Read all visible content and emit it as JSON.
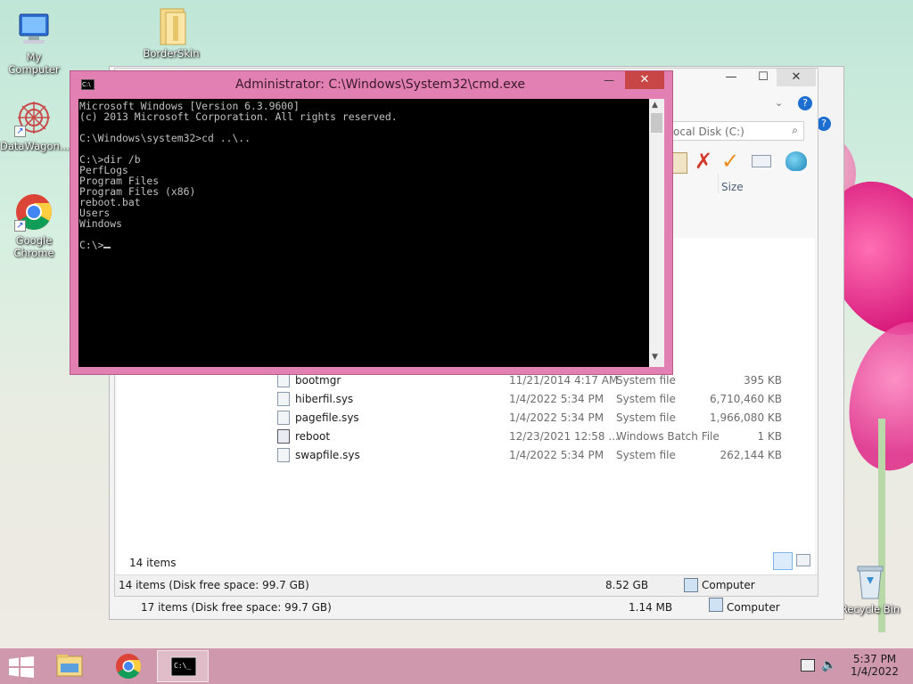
{
  "desktop": {
    "icons": [
      {
        "label": "My Computer"
      },
      {
        "label": "BorderSkin"
      },
      {
        "label": "DataWagon..."
      },
      {
        "label": "Google Chrome"
      },
      {
        "label": "Recycle Bin"
      }
    ]
  },
  "explorer": {
    "search_placeholder": "ocal Disk (C:)",
    "column_size": "Size",
    "files": [
      {
        "name": "bootmgr",
        "date": "11/21/2014 4:17 AM",
        "type": "System file",
        "size": "395 KB"
      },
      {
        "name": "hiberfil.sys",
        "date": "1/4/2022 5:34 PM",
        "type": "System file",
        "size": "6,710,460 KB"
      },
      {
        "name": "pagefile.sys",
        "date": "1/4/2022 5:34 PM",
        "type": "System file",
        "size": "1,966,080 KB"
      },
      {
        "name": "reboot",
        "date": "12/23/2021 12:58 ...",
        "type": "Windows Batch File",
        "size": "1 KB"
      },
      {
        "name": "swapfile.sys",
        "date": "1/4/2022 5:34 PM",
        "type": "System file",
        "size": "262,144 KB"
      }
    ],
    "item_count": "14 items",
    "status_front": {
      "left": "14 items (Disk free space: 99.7 GB)",
      "size": "8.52 GB",
      "location": "Computer"
    },
    "status_back": {
      "left": "17 items (Disk free space: 99.7 GB)",
      "size": "1.14 MB",
      "location": "Computer"
    }
  },
  "cmd": {
    "title": "Administrator: C:\\Windows\\System32\\cmd.exe",
    "output": "Microsoft Windows [Version 6.3.9600]\n(c) 2013 Microsoft Corporation. All rights reserved.\n\nC:\\Windows\\system32>cd ..\\..\n\nC:\\>dir /b\nPerfLogs\nProgram Files\nProgram Files (x86)\nreboot.bat\nUsers\nWindows\n\n",
    "prompt": "C:\\>",
    "colors": {
      "frame": "#e27fb3",
      "close": "#c94646",
      "text": "#c0c0c0",
      "background": "#000000"
    }
  },
  "taskbar": {
    "time": "5:37 PM",
    "date": "1/4/2022"
  }
}
